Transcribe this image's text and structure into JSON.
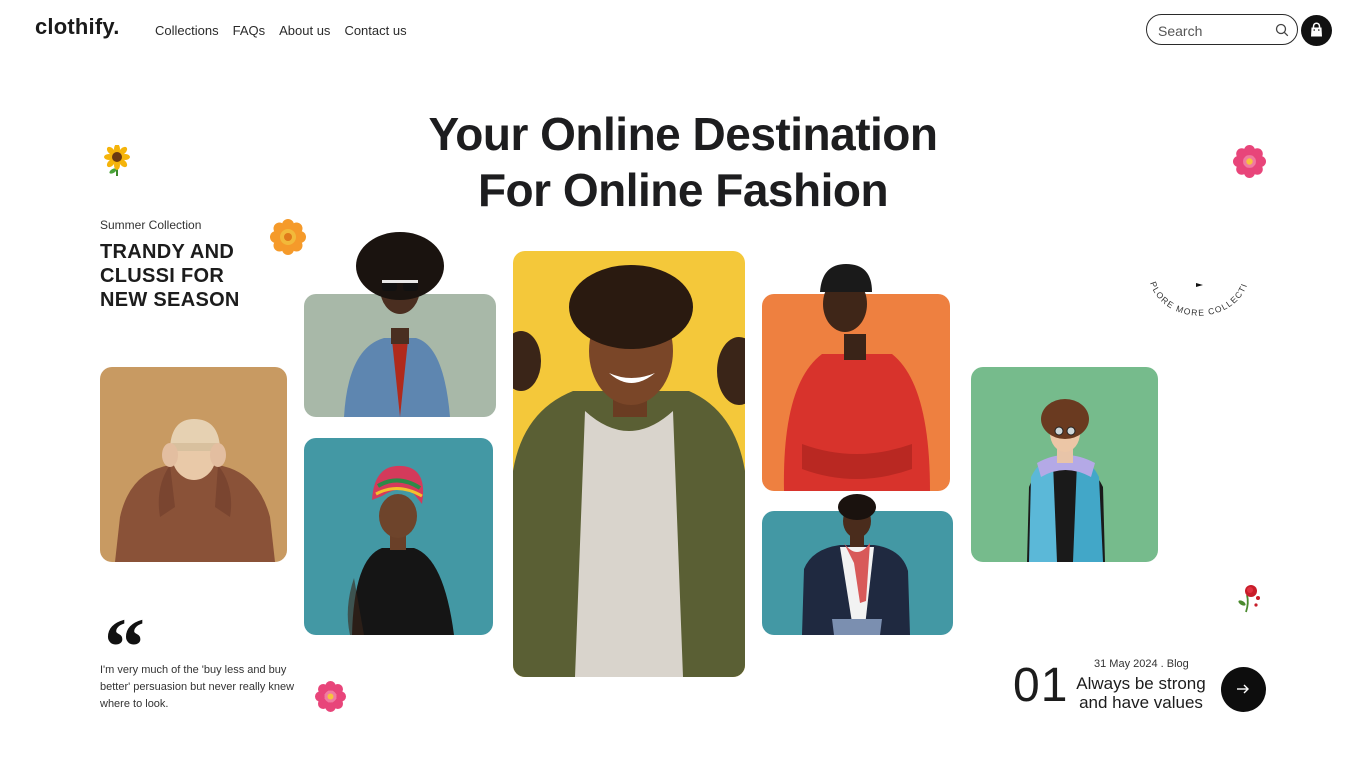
{
  "brand": {
    "logo": "clothify."
  },
  "nav": {
    "items": [
      "Collections",
      "FAQs",
      "About us",
      "Contact us"
    ]
  },
  "search": {
    "placeholder": "Search",
    "value": "",
    "icon": "search-icon"
  },
  "cart": {
    "icon": "shopping-bag-icon"
  },
  "hero": {
    "title_line1": "Your Online Destination",
    "title_line2": "For Online Fashion"
  },
  "summer": {
    "eyebrow": "Summer Collection",
    "headline_line1": "TRANDY AND",
    "headline_line2": "CLUSSI FOR",
    "headline_line3": "NEW SEASON"
  },
  "quote": {
    "mark": "“",
    "text": "I'm very much of the 'buy less and buy better' persuasion but never really knew where to look."
  },
  "explore": {
    "ring_text": "EXPLORE MORE COLLECTION"
  },
  "blog": {
    "number": "01",
    "meta": "31 May 2024 . Blog",
    "title_line1": "Always be strong",
    "title_line2": "and have values",
    "arrow_icon": "arrow-right-icon"
  },
  "colors": {
    "tan": "#c89a62",
    "sage": "#a8b8a8",
    "teal": "#4398a4",
    "yellow": "#f4c83a",
    "orange": "#ee8040",
    "green": "#76bb8c",
    "dark": "#111111"
  },
  "decorations": [
    "sunflower-icon",
    "orange-flower-icon",
    "pink-flower-icon",
    "pink-flower-icon",
    "rose-icon"
  ]
}
